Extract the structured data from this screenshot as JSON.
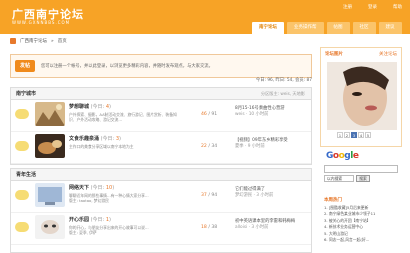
{
  "header": {
    "logo": "广西南宁论坛",
    "logo_sub": "WWW.GXNNBBS.COM",
    "toplinks": [
      "注册",
      "登录",
      "帮助"
    ],
    "tabs": [
      "南宁论坛",
      "业务操作帮",
      "帖图",
      "社区",
      "建议"
    ],
    "active_tab_index": 0
  },
  "breadcrumb": {
    "site": "广西南宁论坛",
    "sep": "»",
    "current": "首页"
  },
  "notice": {
    "post_button": "发帖",
    "text": "您可以注册一个帐号，并以此登录，以浏览更多精彩内容，并随时发布观点，与大家交流。"
  },
  "stats": "今日: 96, 昨日: 54, 会员: 87",
  "sections": [
    {
      "title": "南宁城市",
      "moderators": "分区版主: weis, 天地影",
      "rows": [
        {
          "title": "梦想聊城",
          "today_label": "(今日:",
          "today_num": "4",
          "today_end": ")",
          "desc": "户外探索、摄影，AA制活动交流、旅行游记、图片赏析、装备知识、户外活动攻略、游记交流…",
          "count_a": "46",
          "count_b": "91",
          "last_title": "8月15-16号奏曲性心营游",
          "last_meta": "weis · 10 小时前"
        },
        {
          "title": "文食乐趣泉涌",
          "today_label": "(今日:",
          "today_num": "3",
          "today_end": ")",
          "desc": "主作口的美食分享区域以南宁本地为主",
          "count_a": "22",
          "count_b": "34",
          "last_title": "【视频】09年东乡精彩享受",
          "last_meta": "夏季 · 9 小时前"
        }
      ]
    },
    {
      "title": "青年生活",
      "moderators": "",
      "rows": [
        {
          "title": "网络天下",
          "today_label": "(今日:",
          "today_num": "10",
          "today_end": ")",
          "desc": "聊聊近年网的那些事情…有一种心情大家分享…",
          "moderator": "版主: taotao, 梦幻游民",
          "count_a": "37",
          "count_b": "94",
          "last_title": "它们能过得满了",
          "last_meta": "梦幻游民 · 3 小时前"
        },
        {
          "title": "开心乐园",
          "today_label": "(今日:",
          "today_num": "1",
          "today_end": ")",
          "desc": "你的开心，与朋友分享出来的开心故事可以说…",
          "moderator": "版主: 夏季, 伊萨",
          "count_a": "18",
          "count_b": "38",
          "last_title": "初中英语课本里的李雷和韩梅梅",
          "last_meta": "alloisi · 3 小时前"
        }
      ]
    }
  ],
  "sidebar": {
    "photo_head": "论坛图片",
    "photo_more": "关注论坛",
    "pager": [
      "1",
      "2",
      "3",
      "4",
      "5"
    ],
    "pager_active": 2,
    "google_label": "Google",
    "select_label": "以内搜索",
    "search_btn": "搜索",
    "hot_head": "本周热门",
    "hot_list": [
      "1. [图酷收藏]5月后来更新",
      "2. 南宁绿色某业城市少领子11",
      "3. 被关心的开团【南宁站】",
      "4. 新技术业务运营中心",
      "5. 大明山游记",
      "6. 同志一起,风言一起(好..."
    ]
  },
  "colors": {
    "accent": "#f7a326",
    "link": "#e7792c",
    "tab_active_text": "#e28306"
  }
}
